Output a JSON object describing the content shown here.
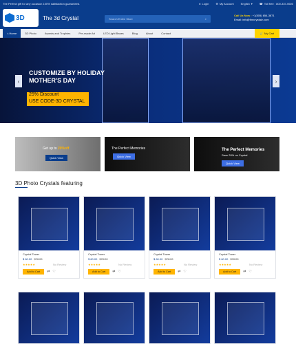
{
  "topbar": {
    "promo": "The Perfect gift for any occasion 100% satisfaction guaranteed.",
    "login": "Login",
    "my_account": "My Account",
    "language": "English",
    "tollfree": "Toll free : 800-337-0600"
  },
  "header": {
    "brand": "The 3d Crystal",
    "logo_text": "3D",
    "search_placeholder": "Search Entire Store",
    "callus_label": "Call Us Now :",
    "callus_phone": "+1(505) 654-3871",
    "email": "Email: info@thecrystalz.com"
  },
  "nav": {
    "items": [
      "Home",
      "3D Photo",
      "Awards and Trophies",
      "Pre-made Art",
      "LED Light Bases",
      "Blog",
      "About",
      "Contact"
    ],
    "cart": "My Cart"
  },
  "hero": {
    "line1": "CUSTOMIZE BY HOLIDAY",
    "line2": "MOTHER'S DAY",
    "discount": "25% Discount",
    "code": "USE CODE-3D CRYSTAL"
  },
  "promos": [
    {
      "title": "Get up to",
      "highlight": "20%off",
      "btn": "Quick View"
    },
    {
      "title": "The Perfect Memories",
      "btn": "Quick View"
    },
    {
      "title": "The Perfect Memories",
      "sub": "Save 20% on Crystal",
      "btn": "Quick View"
    }
  ],
  "section": {
    "title": "3D Photo Crystals featuring"
  },
  "products": [
    {
      "name": "Crystal Tower",
      "price": "$ 60.00",
      "old": "$78.00",
      "review": "No Review",
      "add": "Add to Cart"
    },
    {
      "name": "Crystal Tower",
      "price": "$ 60.00",
      "old": "$78.00",
      "review": "No Review",
      "add": "Add to Cart"
    },
    {
      "name": "Crystal Tower",
      "price": "$ 60.00",
      "old": "$78.00",
      "review": "No Review",
      "add": "Add to Cart"
    },
    {
      "name": "Crystal Tower",
      "price": "$ 60.00",
      "old": "$78.00",
      "review": "No Review",
      "add": "Add to Cart"
    }
  ],
  "icons": {
    "search": "search-icon",
    "login": "user-icon",
    "account": "gear-icon",
    "phone": "phone-icon",
    "cart": "cart-icon",
    "heart": "heart-icon",
    "compare": "compare-icon",
    "arrow_left": "chevron-left-icon",
    "arrow_right": "chevron-right-icon"
  }
}
